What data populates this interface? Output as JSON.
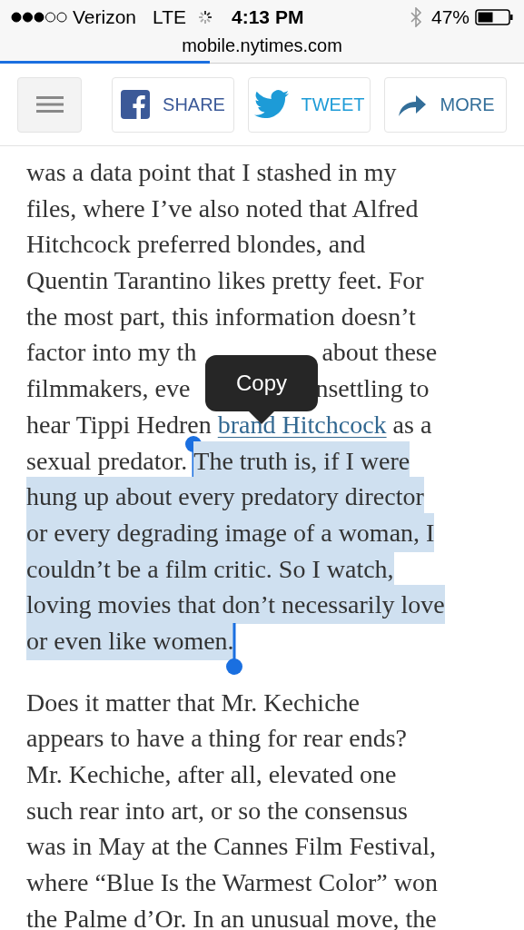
{
  "status_bar": {
    "carrier": "Verizon",
    "network": "LTE",
    "time": "4:13 PM",
    "battery": "47%"
  },
  "address_bar": {
    "url": "mobile.nytimes.com",
    "level": 0.4
  },
  "toolbar": {
    "buttons": [
      {
        "kind": "facebook",
        "label": "SHARE"
      },
      {
        "kind": "twitter",
        "label": "TWEET"
      },
      {
        "kind": "more",
        "label": "MORE"
      }
    ]
  },
  "article": {
    "paragraphs": [
      {
        "lines": [
          {
            "segments": [
              {
                "kind": "text",
                "text": "was a data point that I stashed in my",
                "selected": false
              }
            ]
          },
          {
            "segments": [
              {
                "kind": "text",
                "text": "files, where I’ve also noted that Alfred",
                "selected": false
              }
            ]
          },
          {
            "segments": [
              {
                "kind": "text",
                "text": "Hitchcock preferred blondes, and",
                "selected": false
              }
            ]
          },
          {
            "segments": [
              {
                "kind": "text",
                "text": "Quentin Tarantino likes pretty feet. For",
                "selected": false
              }
            ]
          },
          {
            "segments": [
              {
                "kind": "text",
                "text": "the most part, this information doesn’t",
                "selected": false
              }
            ]
          },
          {
            "segments": [
              {
                "kind": "text",
                "text": "factor into my th",
                "selected": false
              },
              {
                "kind": "covered"
              },
              {
                "kind": "text",
                "text": "about these",
                "selected": false
              }
            ]
          },
          {
            "segments": [
              {
                "kind": "text",
                "text": "filmmakers, eve",
                "selected": false
              },
              {
                "kind": "covered"
              },
              {
                "kind": "text",
                "text": "nsettling to",
                "selected": false
              }
            ]
          },
          {
            "segments": [
              {
                "kind": "text",
                "text": "hear Tippi Hedren ",
                "selected": false
              },
              {
                "kind": "link",
                "text": "brand Hitchcock",
                "selected": false
              },
              {
                "kind": "text",
                "text": " as a",
                "selected": false
              }
            ]
          },
          {
            "segments": [
              {
                "kind": "text",
                "text": "sexual predator. ",
                "selected": false
              },
              {
                "kind": "text",
                "text": "The truth is, if I were",
                "selected": true
              }
            ]
          },
          {
            "segments": [
              {
                "kind": "text",
                "text": "hung up about every predatory director",
                "selected": true
              }
            ]
          },
          {
            "segments": [
              {
                "kind": "text",
                "text": "or every degrading image of a woman, I",
                "selected": true
              }
            ]
          },
          {
            "segments": [
              {
                "kind": "text",
                "text": "couldn’t be a film critic. So I watch,",
                "selected": true
              }
            ]
          },
          {
            "segments": [
              {
                "kind": "text",
                "text": "loving movies that don’t necessarily love",
                "selected": true
              }
            ]
          },
          {
            "segments": [
              {
                "kind": "text",
                "text": "or even like women.",
                "selected": true
              }
            ]
          }
        ]
      },
      {
        "lines": [
          {
            "segments": [
              {
                "kind": "text",
                "text": "Does it matter that Mr. Kechiche",
                "selected": false
              }
            ]
          },
          {
            "segments": [
              {
                "kind": "text",
                "text": "appears to have a thing for rear ends?",
                "selected": false
              }
            ]
          },
          {
            "segments": [
              {
                "kind": "text",
                "text": "Mr. Kechiche, after all, elevated one",
                "selected": false
              }
            ]
          },
          {
            "segments": [
              {
                "kind": "text",
                "text": "such rear into art, or so the consensus",
                "selected": false
              }
            ]
          },
          {
            "segments": [
              {
                "kind": "text",
                "text": "was in May at the Cannes Film Festival,",
                "selected": false
              }
            ]
          },
          {
            "segments": [
              {
                "kind": "text",
                "text": "where “Blue Is the Warmest Color” won",
                "selected": false
              }
            ]
          },
          {
            "segments": [
              {
                "kind": "text",
                "text": "the Palme d’Or. In an unusual move, the",
                "selected": false
              }
            ]
          }
        ]
      }
    ]
  },
  "popover": {
    "label": "Copy"
  }
}
